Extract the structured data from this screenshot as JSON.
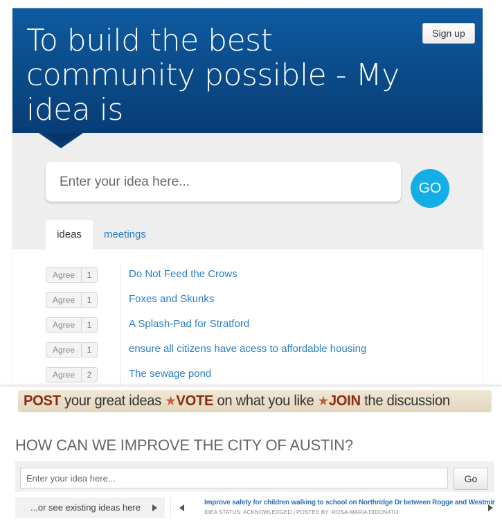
{
  "top_widget": {
    "headline": "To build the best community possible - My idea is",
    "signup_label": "Sign up",
    "idea_input_placeholder": "Enter your idea here...",
    "go_label": "GO",
    "tabs": [
      {
        "label": "ideas",
        "active": true
      },
      {
        "label": "meetings",
        "active": false
      }
    ],
    "agree_label": "Agree",
    "ideas": [
      {
        "title": "Do Not Feed the Crows",
        "votes": "1"
      },
      {
        "title": "Foxes and Skunks",
        "votes": "1"
      },
      {
        "title": "A Splash-Pad for Stratford",
        "votes": "1"
      },
      {
        "title": "ensure all citizens have acess to affordable housing",
        "votes": "1"
      },
      {
        "title": "The sewage pond",
        "votes": "2"
      }
    ],
    "colors": {
      "hero": "#0a4a88",
      "go_button": "#13aee6",
      "link": "#2a7ec4"
    }
  },
  "bottom_widget": {
    "banner": {
      "post": "POST",
      "post_rest": "your great ideas",
      "vote": "VOTE",
      "vote_rest": "on what you like",
      "join": "JOIN",
      "join_rest": "the discussion"
    },
    "question": "HOW CAN WE IMPROVE THE CITY OF AUSTIN?",
    "idea_input_placeholder": "Enter your idea here...",
    "go_label": "Go",
    "see_existing": "...or see existing ideas here",
    "featured_idea": {
      "title": "Improve safety for children walking to school on Northridge Dr between Rogge and Westminster",
      "meta": "IDEA STATUS: ACKNOWLEDGED | POSTED BY :ROSA-MARIA DIDONATO"
    },
    "colors": {
      "banner_accent": "#8a2b12",
      "link": "#2f6fb8"
    }
  }
}
